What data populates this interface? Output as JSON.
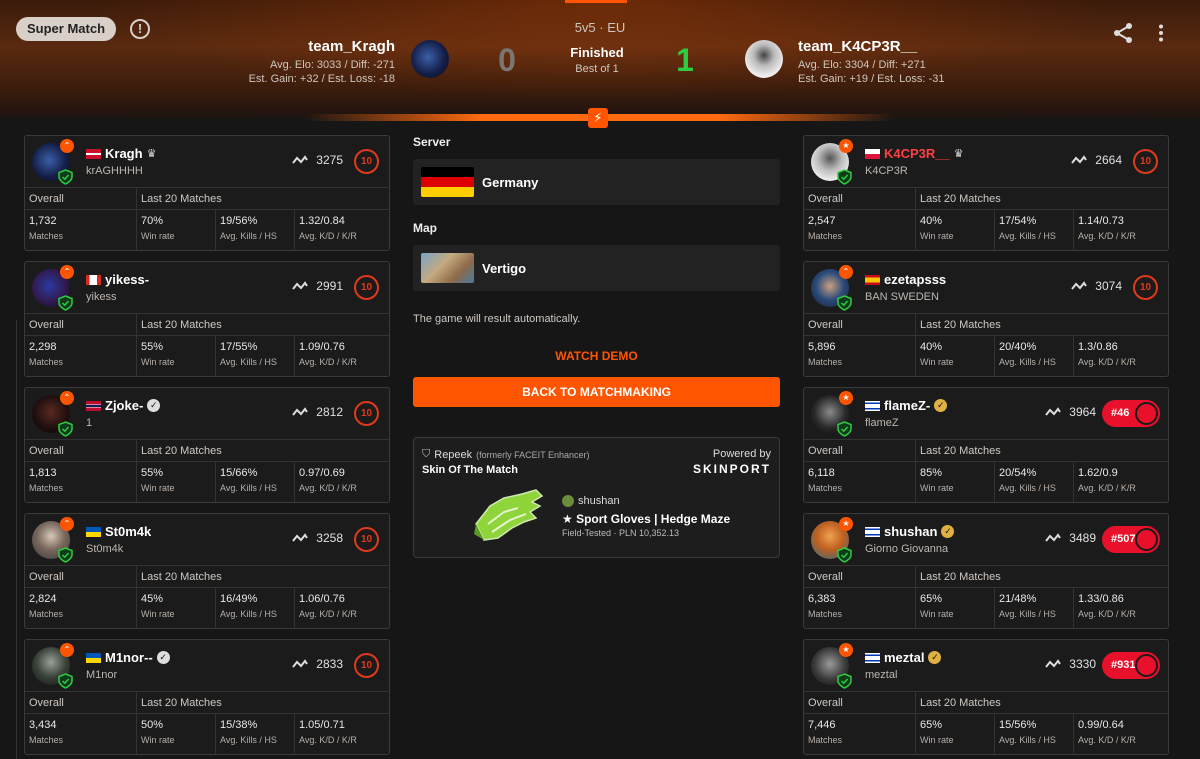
{
  "header": {
    "badge": "Super Match",
    "mode": "5v5 · EU",
    "status": "Finished",
    "best_of": "Best of 1",
    "team_left": {
      "name": "team_Kragh",
      "elo": "Avg. Elo: 3033 / Diff: -271",
      "gain": "Est. Gain: +32 / Est. Loss: -18",
      "score": "0"
    },
    "team_right": {
      "name": "team_K4CP3R__",
      "elo": "Avg. Elo: 3304 / Diff: +271",
      "gain": "Est. Gain: +19 / Est. Loss: -31",
      "score": "1"
    }
  },
  "labels": {
    "overall": "Overall",
    "last20": "Last 20 Matches",
    "matches": "Matches",
    "win_rate": "Win rate",
    "avg_kills": "Avg. Kills / HS",
    "avg_kd": "Avg. K/D / K/R"
  },
  "left_players": [
    {
      "name": "Kragh",
      "nick": "krAGHHHH",
      "elo": "3275",
      "level": "10",
      "matches": "1,732",
      "win": "70%",
      "kills": "19/56%",
      "kd": "1.32/0.84"
    },
    {
      "name": "yikess-",
      "nick": "yikess",
      "elo": "2991",
      "level": "10",
      "matches": "2,298",
      "win": "55%",
      "kills": "17/55%",
      "kd": "1.09/0.76"
    },
    {
      "name": "Zjoke-",
      "nick": "1",
      "elo": "2812",
      "level": "10",
      "matches": "1,813",
      "win": "55%",
      "kills": "15/66%",
      "kd": "0.97/0.69"
    },
    {
      "name": "St0m4k",
      "nick": "St0m4k",
      "elo": "3258",
      "level": "10",
      "matches": "2,824",
      "win": "45%",
      "kills": "16/49%",
      "kd": "1.06/0.76"
    },
    {
      "name": "M1nor--",
      "nick": "M1nor",
      "elo": "2833",
      "level": "10",
      "matches": "3,434",
      "win": "50%",
      "kills": "15/38%",
      "kd": "1.05/0.71"
    }
  ],
  "right_players": [
    {
      "name": "K4CP3R__",
      "nick": "K4CP3R",
      "elo": "2664",
      "level": "10",
      "matches": "2,547",
      "win": "40%",
      "kills": "17/54%",
      "kd": "1.14/0.73"
    },
    {
      "name": "ezetapsss",
      "nick": "BAN SWEDEN",
      "elo": "3074",
      "level": "10",
      "matches": "5,896",
      "win": "40%",
      "kills": "20/40%",
      "kd": "1.3/0.86"
    },
    {
      "name": "flameZ-",
      "nick": "flameZ",
      "elo": "3964",
      "rank": "#46",
      "matches": "6,118",
      "win": "85%",
      "kills": "20/54%",
      "kd": "1.62/0.9"
    },
    {
      "name": "shushan",
      "nick": "Giorno Giovanna",
      "elo": "3489",
      "rank": "#507",
      "matches": "6,383",
      "win": "65%",
      "kills": "21/48%",
      "kd": "1.33/0.86"
    },
    {
      "name": "meztal",
      "nick": "meztal",
      "elo": "3330",
      "rank": "#931",
      "matches": "7,446",
      "win": "65%",
      "kills": "15/56%",
      "kd": "0.99/0.64"
    }
  ],
  "center": {
    "server_label": "Server",
    "server": "Germany",
    "map_label": "Map",
    "map": "Vertigo",
    "auto_text": "The game will result automatically.",
    "watch_demo": "WATCH DEMO",
    "back_button": "BACK TO MATCHMAKING"
  },
  "skin": {
    "brand": "Repeek",
    "brand_sub": "(formerly FACEIT Enhancer)",
    "title": "Skin Of The Match",
    "powered_by": "Powered by",
    "provider": "SKINPORT",
    "user": "shushan",
    "item": "★ Sport Gloves | Hedge Maze",
    "meta": "Field-Tested · PLN 10,352.13"
  },
  "colors": {
    "accent": "#ff5500",
    "win": "#2ecc40",
    "rank": "#e8102a"
  }
}
